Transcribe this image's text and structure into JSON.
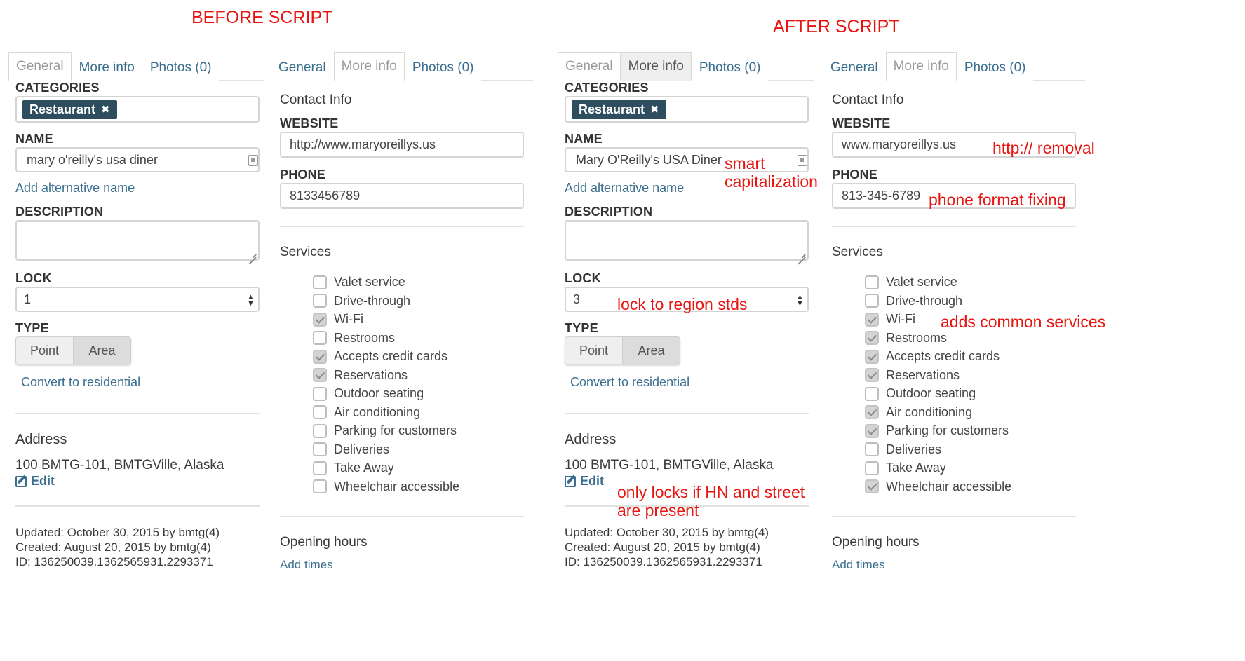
{
  "titles": {
    "before": "BEFORE SCRIPT",
    "after": "AFTER SCRIPT"
  },
  "annotations": {
    "smart_cap": "smart\ncapitalization",
    "http_removal": "http:// removal",
    "phone_fix": "phone format fixing",
    "lock_region": "lock to region stds",
    "common_services": "adds common services",
    "only_locks": "only locks if HN and street\nare present"
  },
  "tabs": {
    "general": "General",
    "more_info": "More info",
    "photos": "Photos (0)"
  },
  "general_form": {
    "categories_label": "CATEGORIES",
    "category_chip": "Restaurant",
    "chip_remove": "✖",
    "name_label": "NAME",
    "add_alt_name": "Add alternative name",
    "description_label": "DESCRIPTION",
    "lock_label": "LOCK",
    "type_label": "TYPE",
    "type_point": "Point",
    "type_area": "Area",
    "convert_residential": "Convert to residential",
    "address_heading": "Address",
    "address_value": "100 BMTG-101, BMTGVille, Alaska",
    "edit_label": "Edit",
    "updated": "Updated: October 30, 2015 by bmtg(4)",
    "created": "Created: August 20, 2015 by bmtg(4)",
    "id": "ID: 136250039.1362565931.2293371"
  },
  "before_general": {
    "name_value": "mary o'reilly's usa diner",
    "lock_value": "1"
  },
  "after_general": {
    "name_value": "Mary O'Reilly's USA Diner",
    "lock_value": "3"
  },
  "more_info_form": {
    "contact_heading": "Contact Info",
    "website_label": "WEBSITE",
    "phone_label": "PHONE",
    "services_heading": "Services",
    "opening_hours": "Opening hours",
    "add_times": "Add times",
    "services": [
      "Valet service",
      "Drive-through",
      "Wi-Fi",
      "Restrooms",
      "Accepts credit cards",
      "Reservations",
      "Outdoor seating",
      "Air conditioning",
      "Parking for customers",
      "Deliveries",
      "Take Away",
      "Wheelchair accessible"
    ]
  },
  "before_more": {
    "website": "http://www.maryoreillys.us",
    "phone": "8133456789",
    "checked": [
      false,
      false,
      true,
      false,
      true,
      true,
      false,
      false,
      false,
      false,
      false,
      false
    ]
  },
  "after_more": {
    "website": "www.maryoreillys.us",
    "phone": "813-345-6789",
    "checked": [
      false,
      false,
      true,
      true,
      true,
      true,
      false,
      true,
      true,
      false,
      false,
      true
    ]
  },
  "colors": {
    "annotation": "#e8140f",
    "chip": "#2e4d5e",
    "link": "#3a6e8f"
  }
}
